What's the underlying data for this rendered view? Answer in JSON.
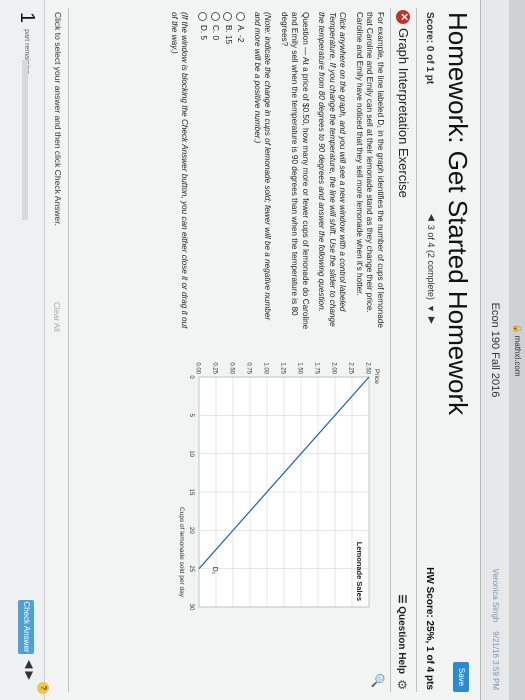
{
  "browser": {
    "url": "mathxl.com"
  },
  "header": {
    "course": "Econ 190 Fall 2016",
    "user": "Veronica Singh",
    "date": "9/21/16 3:59 PM"
  },
  "homework": {
    "title": "Homework: Get Started Homework",
    "save_label": "Save",
    "score": "Score: 0 of 1 pt",
    "nav_label": "3 of 4 (2 complete)",
    "hw_score": "HW Score: 25%, 1 of 4 pts"
  },
  "exercise": {
    "title": "Graph Interpretation Exercise",
    "question_help": "Question Help",
    "para1": "For example, the line labeled D₁ in the graph identifies the number of cups of lemonade that Caroline and Emily can sell at their lemonade stand as they change their price. Caroline and Emily have noticed that they sell more lemonade when it's hotter.",
    "para2": "Click anywhere on the graph, and you will see a new window with a control labeled Temperature. If you change the temperature, the line will shift. Use the slider to change the temperature from 80 degrees to 90 degrees and answer the following question.",
    "para3": "Question — At a price of $0.50, how many more or fewer cups of lemonade do Caroline and Emily sell when the temperature is 90 degrees than when the temperature is 80 degrees?",
    "para4": "(Note: indicate the change in cups of lemonade sold; fewer will be a negative number and more will be a positive number.)",
    "choices": [
      "A.  -2",
      "B.  15",
      "C.  0",
      "D.  5"
    ],
    "note": "(If the window is blocking the Check Answer button, you can either close it or drag it out of the way.)",
    "instruction": "Click to select your answer and then click Check Answer.",
    "clear_all": "Clear All"
  },
  "footer": {
    "part_number": "1",
    "part_label": "part remaining",
    "progress": 0,
    "check_answer": "Check Answer"
  },
  "chart_data": {
    "type": "line",
    "title": "Lemonade Sales",
    "xlabel": "Cups of lemonade sold per day",
    "ylabel": "Price",
    "xlim": [
      0,
      30
    ],
    "ylim": [
      0,
      2.5
    ],
    "x_ticks": [
      "0",
      "5",
      "10",
      "15",
      "20",
      "25",
      "30"
    ],
    "y_ticks": [
      "0.00",
      "0.25",
      "0.50",
      "0.75",
      "1.00",
      "1.25",
      "1.50",
      "1.75",
      "2.00",
      "2.25",
      "2.50"
    ],
    "series": [
      {
        "name": "D₁",
        "x": [
          0,
          25
        ],
        "y": [
          2.5,
          0
        ],
        "color": "#2b6cb0"
      }
    ],
    "grid": true
  }
}
